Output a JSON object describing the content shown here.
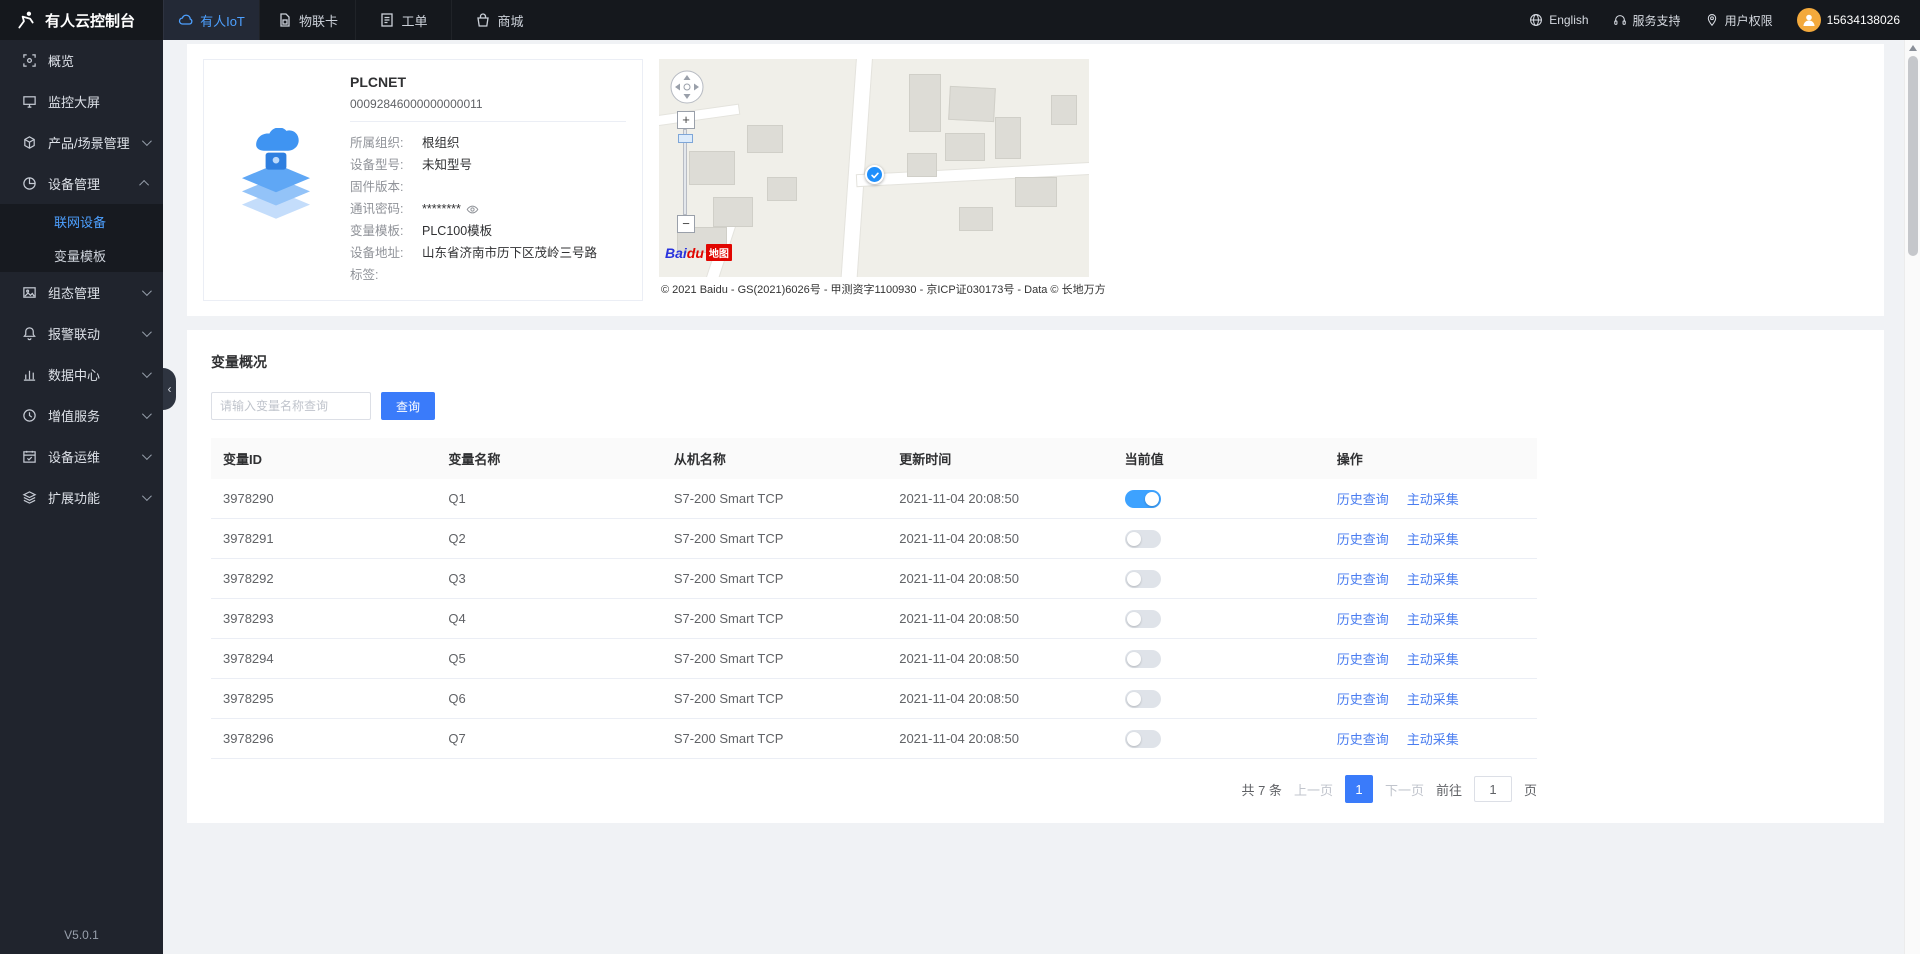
{
  "topbar": {
    "logo": "有人云控制台",
    "tabs": [
      {
        "label": "有人IoT",
        "active": true
      },
      {
        "label": "物联卡",
        "active": false
      },
      {
        "label": "工单",
        "active": false
      },
      {
        "label": "商城",
        "active": false
      }
    ],
    "language": "English",
    "support": "服务支持",
    "permission": "用户权限",
    "phone": "15634138026"
  },
  "sidebar": {
    "items": [
      {
        "label": "概览"
      },
      {
        "label": "监控大屏"
      },
      {
        "label": "产品/场景管理"
      },
      {
        "label": "设备管理",
        "expanded": true,
        "children": [
          {
            "label": "联网设备",
            "active": true
          },
          {
            "label": "变量模板",
            "active": false
          }
        ]
      },
      {
        "label": "组态管理"
      },
      {
        "label": "报警联动"
      },
      {
        "label": "数据中心"
      },
      {
        "label": "增值服务"
      },
      {
        "label": "设备运维"
      },
      {
        "label": "扩展功能"
      }
    ],
    "version": "V5.0.1"
  },
  "device": {
    "name": "PLCNET",
    "id": "00092846000000000011",
    "fields": [
      {
        "label": "所属组织:",
        "value": "根组织"
      },
      {
        "label": "设备型号:",
        "value": "未知型号"
      },
      {
        "label": "固件版本:",
        "value": ""
      },
      {
        "label": "通讯密码:",
        "value": "********"
      },
      {
        "label": "变量模板:",
        "value": "PLC100模板"
      },
      {
        "label": "设备地址:",
        "value": "山东省济南市历下区茂岭三号路"
      },
      {
        "label": "标签:",
        "value": ""
      }
    ]
  },
  "map": {
    "zoom_in": "+",
    "zoom_out": "−",
    "logo_text": "Bai",
    "logo_text2": "du",
    "logo_badge": "地图",
    "copyright": "© 2021 Baidu - GS(2021)6026号 - 甲测资字1100930 - 京ICP证030173号 - Data © 长地万方"
  },
  "variables": {
    "title": "变量概况",
    "search_placeholder": "请输入变量名称查询",
    "search_button": "查询",
    "columns": [
      "变量ID",
      "变量名称",
      "从机名称",
      "更新时间",
      "当前值",
      "操作"
    ],
    "actions": {
      "history": "历史查询",
      "collect": "主动采集"
    },
    "rows": [
      {
        "id": "3978290",
        "name": "Q1",
        "slave": "S7-200 Smart TCP",
        "time": "2021-11-04 20:08:50",
        "on": true
      },
      {
        "id": "3978291",
        "name": "Q2",
        "slave": "S7-200 Smart TCP",
        "time": "2021-11-04 20:08:50",
        "on": false
      },
      {
        "id": "3978292",
        "name": "Q3",
        "slave": "S7-200 Smart TCP",
        "time": "2021-11-04 20:08:50",
        "on": false
      },
      {
        "id": "3978293",
        "name": "Q4",
        "slave": "S7-200 Smart TCP",
        "time": "2021-11-04 20:08:50",
        "on": false
      },
      {
        "id": "3978294",
        "name": "Q5",
        "slave": "S7-200 Smart TCP",
        "time": "2021-11-04 20:08:50",
        "on": false
      },
      {
        "id": "3978295",
        "name": "Q6",
        "slave": "S7-200 Smart TCP",
        "time": "2021-11-04 20:08:50",
        "on": false
      },
      {
        "id": "3978296",
        "name": "Q7",
        "slave": "S7-200 Smart TCP",
        "time": "2021-11-04 20:08:50",
        "on": false
      }
    ],
    "pagination": {
      "total": "共 7 条",
      "prev": "上一页",
      "page": "1",
      "next": "下一页",
      "jump_label": "前往",
      "jump_value": "1",
      "jump_unit": "页"
    }
  }
}
